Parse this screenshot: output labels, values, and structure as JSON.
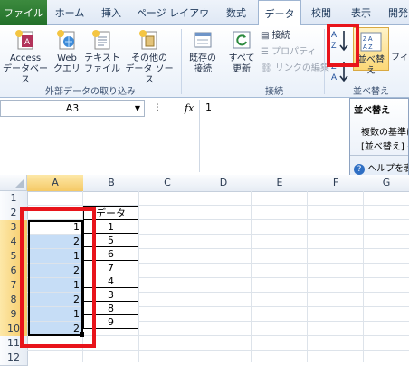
{
  "ribbon_tabs": [
    "ファイル",
    "ホーム",
    "挿入",
    "ページ レイアウト",
    "数式",
    "データ",
    "校閲",
    "表示",
    "開発"
  ],
  "external_group": {
    "buttons": [
      {
        "line1": "Access",
        "line2": "データベース"
      },
      {
        "line1": "Web",
        "line2": "クエリ"
      },
      {
        "line1": "テキスト",
        "line2": "ファイル"
      },
      {
        "line1": "その他の",
        "line2": "データ ソース"
      }
    ],
    "label": "外部データの取り込み"
  },
  "existing_conn": {
    "line1": "既存の",
    "line2": "接続"
  },
  "connections_group": {
    "refresh": {
      "line1": "すべて",
      "line2": "更新"
    },
    "items": [
      "接続",
      "プロパティ",
      "リンクの編集"
    ],
    "label": "接続"
  },
  "sort_group": {
    "sort_button": "並べ替え",
    "filter_button": "フィル",
    "label": "並べ替え"
  },
  "formula_bar": {
    "name_box": "A3",
    "fx": "fx",
    "value": "1"
  },
  "tooltip": {
    "title": "並べ替え",
    "line1": "複数の基準に",
    "line2": "[並べ替え] ダ",
    "help": "ヘルプを表"
  },
  "sheet": {
    "columns": [
      "A",
      "B",
      "C",
      "D",
      "E",
      "F",
      "G"
    ],
    "rows": [
      "1",
      "2",
      "3",
      "4",
      "5",
      "6",
      "7",
      "8",
      "9",
      "10",
      "11",
      "12"
    ],
    "header_b2": "データ",
    "col_a_values": [
      "1",
      "2",
      "1",
      "2",
      "1",
      "2",
      "1",
      "2"
    ],
    "col_b_values": [
      "1",
      "5",
      "6",
      "7",
      "4",
      "3",
      "8",
      "9"
    ]
  },
  "colors": {
    "highlight": "#e8141b",
    "selection": "#c6ddf6",
    "file_tab": "#2f7d32"
  }
}
